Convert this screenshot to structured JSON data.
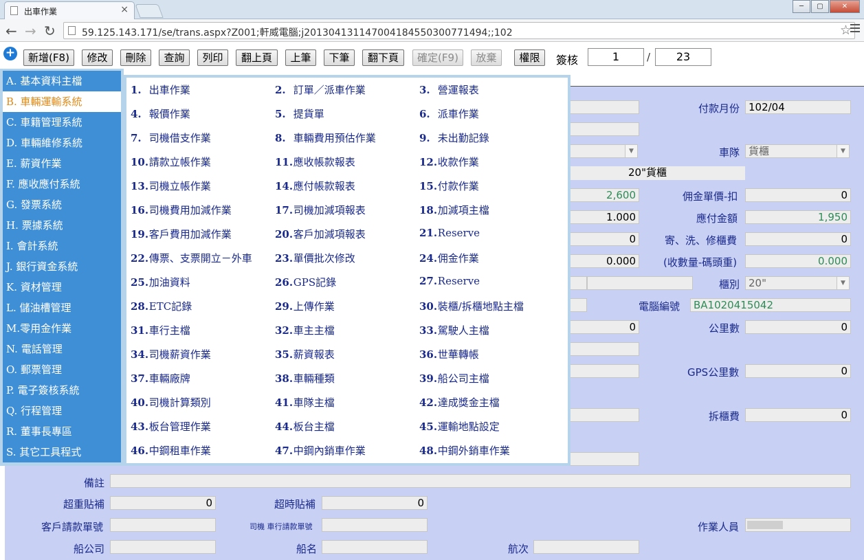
{
  "browser": {
    "tab_title": "出車作業",
    "tab_close": "×",
    "win_min": "─",
    "win_max": "▢",
    "win_close": "✕",
    "back": "←",
    "forward": "→",
    "reload": "↻",
    "url": "59.125.143.171/se/trans.aspx?Z001;軒威電腦;j20130413114700418455030077​1494;;102",
    "star": "☆"
  },
  "toolbar": {
    "add_icon": "+",
    "buttons": [
      "新增(F8)",
      "修改",
      "刪除",
      "查詢",
      "列印",
      "翻上頁",
      "上筆",
      "下筆",
      "翻下頁",
      "確定(F9)",
      "放棄",
      "權限"
    ],
    "sign_label": "簽核",
    "page_current": "1",
    "page_separator": "/",
    "page_total": "23"
  },
  "sidebar": {
    "items": [
      "A. 基本資料主檔",
      "B. 車輛運輸系統",
      "C. 車籍管理系統",
      "D. 車輛維修系統",
      "E. 薪資作業",
      "F. 應收應付系統",
      "G. 發票系統",
      "H. 票據系統",
      "I.  會計系統",
      "J. 銀行資金系統",
      "K. 資材管理",
      "L. 儲油槽管理",
      "M.零用金作業",
      "N. 電話管理",
      "O. 郵票管理",
      "P. 電子簽核系統",
      "Q. 行程管理",
      "R. 董事長專區",
      "S. 其它工具程式"
    ]
  },
  "menu": {
    "items": [
      {
        "num": "1.",
        "label": "出車作業"
      },
      {
        "num": "2.",
        "label": "訂單／派車作業"
      },
      {
        "num": "3.",
        "label": "營運報表"
      },
      {
        "num": "4.",
        "label": "報價作業"
      },
      {
        "num": "5.",
        "label": "提貨單"
      },
      {
        "num": "6.",
        "label": "派車作業"
      },
      {
        "num": "7.",
        "label": "司機借支作業"
      },
      {
        "num": "8.",
        "label": "車輛費用預估作業"
      },
      {
        "num": "9.",
        "label": "未出勤記錄"
      },
      {
        "num": "10.",
        "label": "請款立帳作業"
      },
      {
        "num": "11.",
        "label": "應收帳款報表"
      },
      {
        "num": "12.",
        "label": "收款作業"
      },
      {
        "num": "13.",
        "label": "司機立帳作業"
      },
      {
        "num": "14.",
        "label": "應付帳款報表"
      },
      {
        "num": "15.",
        "label": "付款作業"
      },
      {
        "num": "16.",
        "label": "司機費用加減作業"
      },
      {
        "num": "17.",
        "label": "司機加減項報表"
      },
      {
        "num": "18.",
        "label": "加減項主檔"
      },
      {
        "num": "19.",
        "label": "客戶費用加減作業"
      },
      {
        "num": "20.",
        "label": "客戶加減項報表"
      },
      {
        "num": "21.",
        "label": "Reserve"
      },
      {
        "num": "22.",
        "label": "傳票、支票開立－外車"
      },
      {
        "num": "23.",
        "label": "單價批次修改"
      },
      {
        "num": "24.",
        "label": "佣金作業"
      },
      {
        "num": "25.",
        "label": "加油資料"
      },
      {
        "num": "26.",
        "label": "GPS記錄"
      },
      {
        "num": "27.",
        "label": "Reserve"
      },
      {
        "num": "28.",
        "label": "ETC記錄"
      },
      {
        "num": "29.",
        "label": "上傳作業"
      },
      {
        "num": "30.",
        "label": "裝櫃/拆櫃地點主檔"
      },
      {
        "num": "31.",
        "label": "車行主檔"
      },
      {
        "num": "32.",
        "label": "車主主檔"
      },
      {
        "num": "33.",
        "label": "駕駛人主檔"
      },
      {
        "num": "34.",
        "label": "司機薪資作業"
      },
      {
        "num": "35.",
        "label": "薪資報表"
      },
      {
        "num": "36.",
        "label": "世華轉帳"
      },
      {
        "num": "37.",
        "label": "車輛廠牌"
      },
      {
        "num": "38.",
        "label": "車輛種類"
      },
      {
        "num": "39.",
        "label": "船公司主檔"
      },
      {
        "num": "40.",
        "label": "司機計算類別"
      },
      {
        "num": "41.",
        "label": "車隊主檔"
      },
      {
        "num": "42.",
        "label": "達成獎金主檔"
      },
      {
        "num": "43.",
        "label": "板台管理作業"
      },
      {
        "num": "44.",
        "label": "板台主檔"
      },
      {
        "num": "45.",
        "label": "運輸地點設定"
      },
      {
        "num": "46.",
        "label": "中鋼租車作業"
      },
      {
        "num": "47.",
        "label": "中鋼內銷車作業"
      },
      {
        "num": "48.",
        "label": "中鋼外銷車作業"
      }
    ]
  },
  "form": {
    "pay_month_label": "付款月份",
    "pay_month": "102/04",
    "fleet_label": "車隊",
    "fleet": "貨櫃",
    "container_type_text": "20\"貨櫃",
    "price_value": "2,600",
    "commission_label": "佣金單價-扣",
    "commission": "0",
    "qty_value": "1.000",
    "payable_label": "應付金額",
    "payable": "1,950",
    "zero_a": "0",
    "storage_label": "寄、洗、修櫃費",
    "storage": "0",
    "zero_b": "0.000",
    "dock_label": "(收數量-碼頭重)",
    "dock": "0.000",
    "cabinet_label": "櫃別",
    "cabinet": "20\"",
    "computer_no_label": "電腦編號",
    "computer_no": "BA1020415042",
    "zero_c": "0",
    "km_label": "公里數",
    "km": "0",
    "gps_km_label": "GPS公里數",
    "gps_km": "0",
    "unload_label": "拆櫃費",
    "unload": "0",
    "remark_label": "備註",
    "overweight_label": "超重貼補",
    "overweight": "0",
    "overtime_label": "超時貼補",
    "overtime": "0",
    "cust_invoice_label": "客戶請款單號",
    "driver_invoice_label": "司機 車行請款單號",
    "operator_label": "作業人員",
    "shipping_co_label": "船公司",
    "ship_name_label": "船名",
    "voyage_label": "航次"
  }
}
